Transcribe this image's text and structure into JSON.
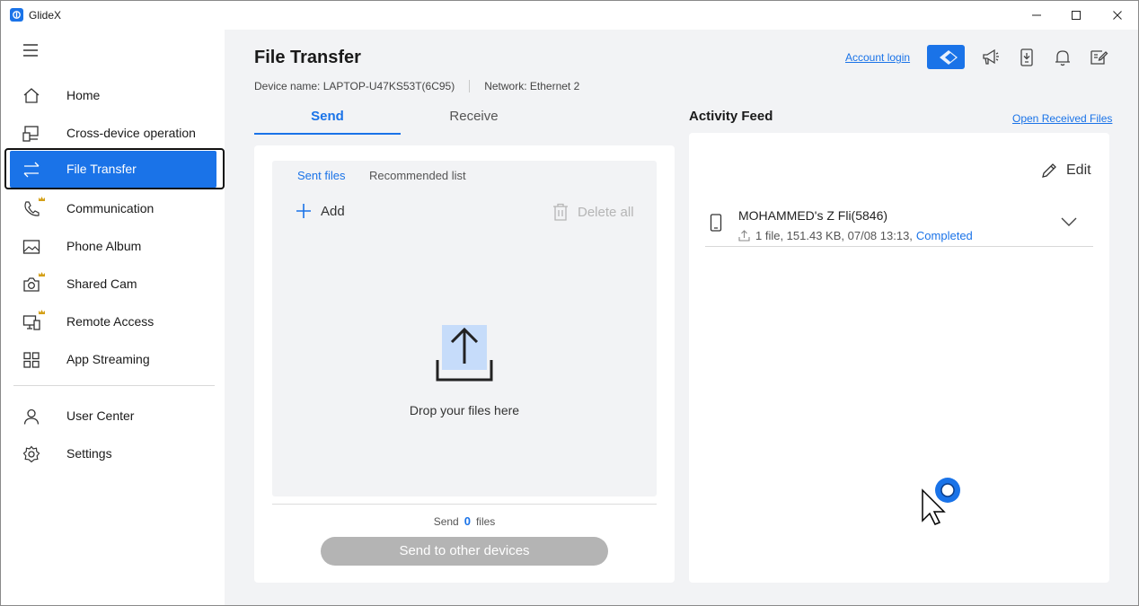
{
  "window": {
    "title": "GlideX"
  },
  "sidebar": {
    "items": [
      {
        "label": "Home",
        "icon": "home-icon"
      },
      {
        "label": "Cross-device operation",
        "icon": "cross-device-icon"
      },
      {
        "label": "File Transfer",
        "icon": "file-transfer-icon",
        "active": true
      },
      {
        "label": "Communication",
        "icon": "phone-call-icon"
      },
      {
        "label": "Phone Album",
        "icon": "photo-icon"
      },
      {
        "label": "Shared Cam",
        "icon": "camera-icon"
      },
      {
        "label": "Remote Access",
        "icon": "remote-access-icon"
      },
      {
        "label": "App Streaming",
        "icon": "apps-grid-icon"
      }
    ],
    "bottom_items": [
      {
        "label": "User Center",
        "icon": "user-icon"
      },
      {
        "label": "Settings",
        "icon": "gear-icon"
      }
    ]
  },
  "header": {
    "title": "File Transfer",
    "device_name": "Device name: LAPTOP-U47KS53T(6C95)",
    "network": "Network: Ethernet 2",
    "account_login": "Account login"
  },
  "tabs": {
    "send": "Send",
    "receive": "Receive"
  },
  "send_panel": {
    "sent_files": "Sent files",
    "recommended_list": "Recommended list",
    "add": "Add",
    "delete_all": "Delete all",
    "drop_text": "Drop your files here",
    "send_prefix": "Send",
    "file_count": "0",
    "send_suffix": "files",
    "send_button": "Send to other devices"
  },
  "activity": {
    "title": "Activity Feed",
    "open_received": "Open Received Files",
    "edit": "Edit",
    "items": [
      {
        "device": "MOHAMMED's Z Fli(5846)",
        "detail": "1 file, 151.43 KB, 07/08 13:13,",
        "status": "Completed"
      }
    ]
  },
  "colors": {
    "accent": "#1a73e8",
    "background": "#f2f3f5",
    "disabled": "#b4b4b4"
  }
}
